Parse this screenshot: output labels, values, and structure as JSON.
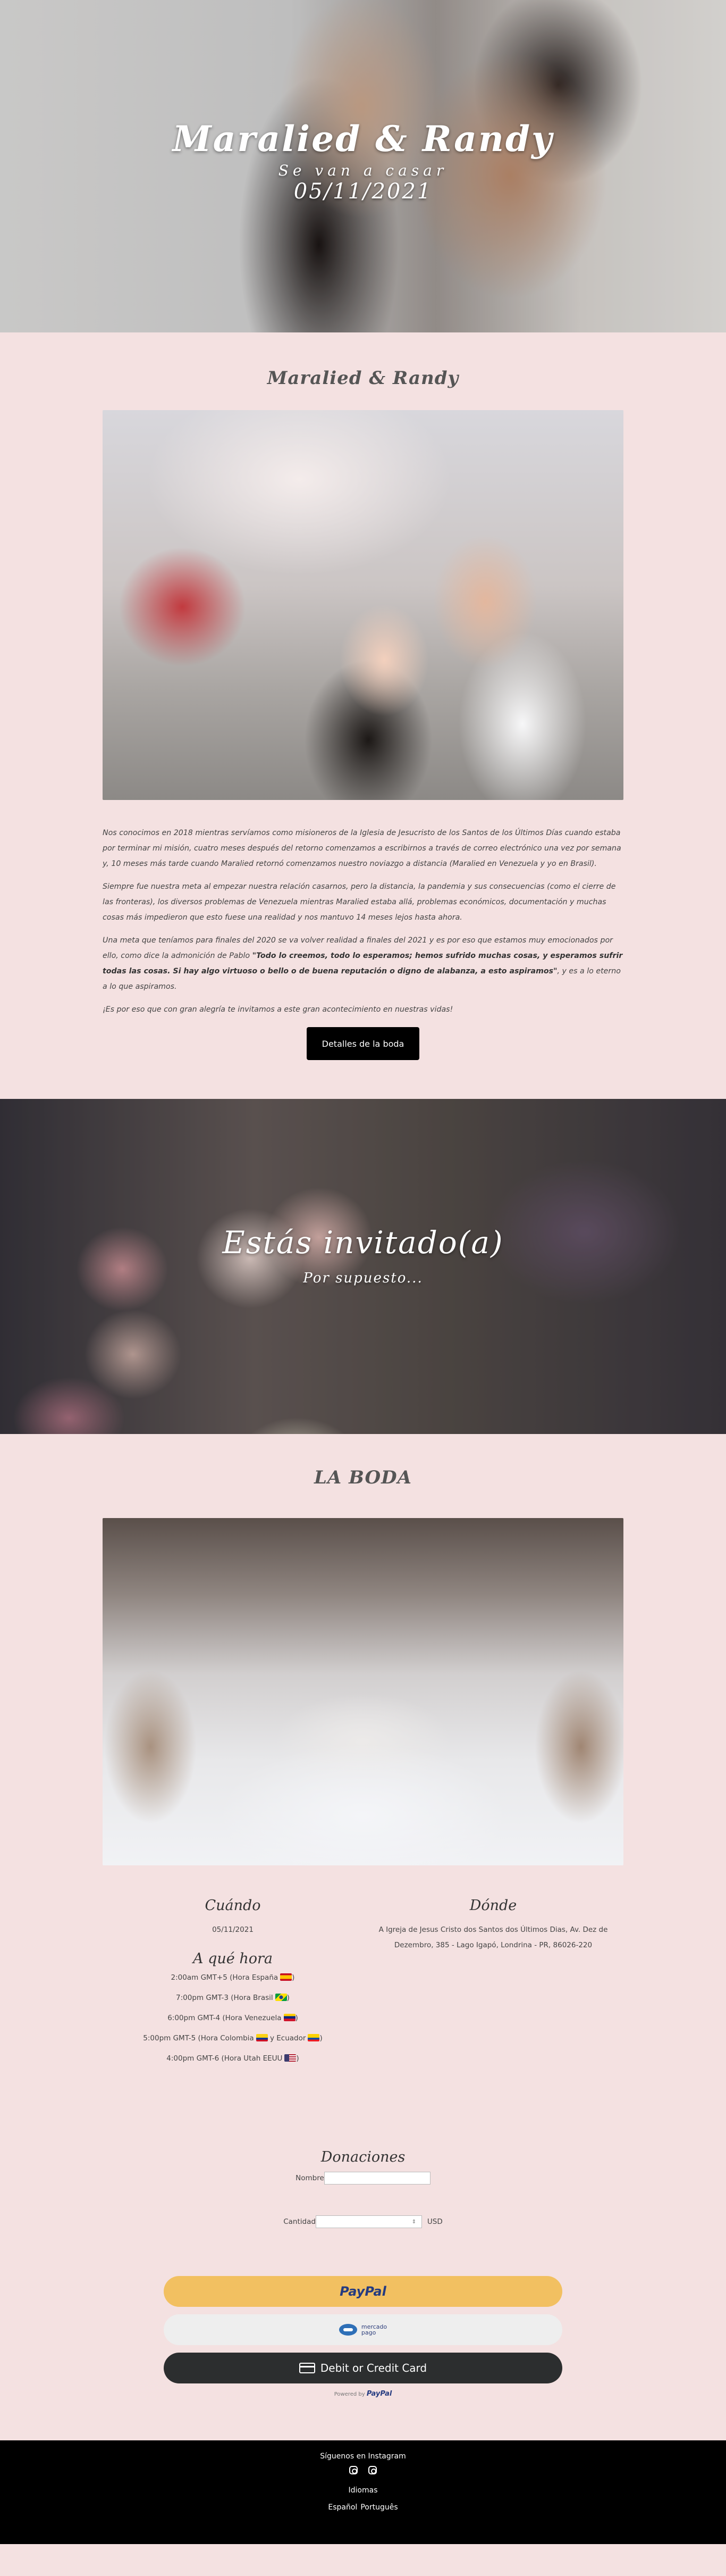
{
  "hero": {
    "title": "Maralied & Randy",
    "subtitle": "Se van a casar",
    "date": "05/11/2021"
  },
  "story": {
    "title": "Maralied & Randy",
    "paragraph1": "Nos conocimos en 2018 mientras servíamos como misioneros de la Iglesia de Jesucristo de los Santos de los Últimos Días cuando estaba por terminar mi misión, cuatro meses después del retorno comenzamos a escribirnos a través de correo electrónico una vez por semana y, 10 meses más tarde cuando Maralied retornó comenzamos nuestro noviazgo a distancia (Maralied en Venezuela y yo en Brasil).",
    "paragraph2": "Siempre fue nuestra meta al empezar nuestra relación casarnos, pero la distancia, la pandemia y sus consecuencias (como el cierre de las fronteras), los diversos problemas de Venezuela mientras Maralied estaba allá, problemas económicos, documentación y muchas cosas más impedieron que esto fuese una realidad y nos mantuvo 14 meses lejos hasta ahora.",
    "paragraph3_start": "Una meta que teníamos para finales del 2020 se va volver realidad a finales del 2021 y es por eso que estamos muy emocionados por ello, como dice la admonición de Pablo ",
    "paragraph3_quote": "\"Todo lo creemos, todo lo esperamos; hemos sufrido muchas cosas, y esperamos sufrir todas las cosas. Si hay algo virtuoso o bello o de buena reputación o digno de alabanza, a esto aspiramos\"",
    "paragraph3_end": ", y es a lo eterno a lo que aspiramos.",
    "paragraph4": "¡Es por eso que con gran alegría te invitamos a este gran acontecimiento en nuestras vidas!",
    "button_label": "Detalles de la boda"
  },
  "invite": {
    "title": "Estás invitado(a)",
    "subtitle": "Por supuesto..."
  },
  "wedding": {
    "title": "LA BODA",
    "when_heading": "Cuándo",
    "when_date": "05/11/2021",
    "time_heading": "A qué hora",
    "times": [
      "2:00am GMT+5 (Hora España",
      "7:00pm GMT-3 (Hora Brasil",
      "6:00pm GMT-4 (Hora Venezuela",
      "5:00pm GMT-5 (Hora Colombia",
      "4:00pm GMT-6 (Hora Utah EEUU"
    ],
    "ecuador_text": "y Ecuador",
    "where_heading": "Dónde",
    "address_line1": "A Igreja de Jesus Cristo dos Santos dos Últimos Dias, Av. Dez de",
    "address_line2": "Dezembro, 385 - Lago Igapó, Londrina - PR, 86026-220"
  },
  "donations": {
    "title": "Donaciones",
    "name_label": "Nombre",
    "name_value": "",
    "amount_label": "Cantidad",
    "amount_value": "",
    "stepper_icon": "⇕",
    "currency": "USD",
    "paypal_label": "PayPal",
    "mercado_line1": "mercado",
    "mercado_line2": "pago",
    "card_label": "Debit or Credit Card",
    "powered_label": "Powered by",
    "powered_brand": "PayPal"
  },
  "footer": {
    "follow": "Síguenos en Instagram",
    "languages_label": "Idiomas",
    "lang_es": "Español",
    "lang_pt": "Português"
  },
  "colors": {
    "background": "#f4e1e1",
    "paypal_yellow": "#f2c061",
    "card_dark": "#2c2e2f",
    "footer": "#000000"
  }
}
